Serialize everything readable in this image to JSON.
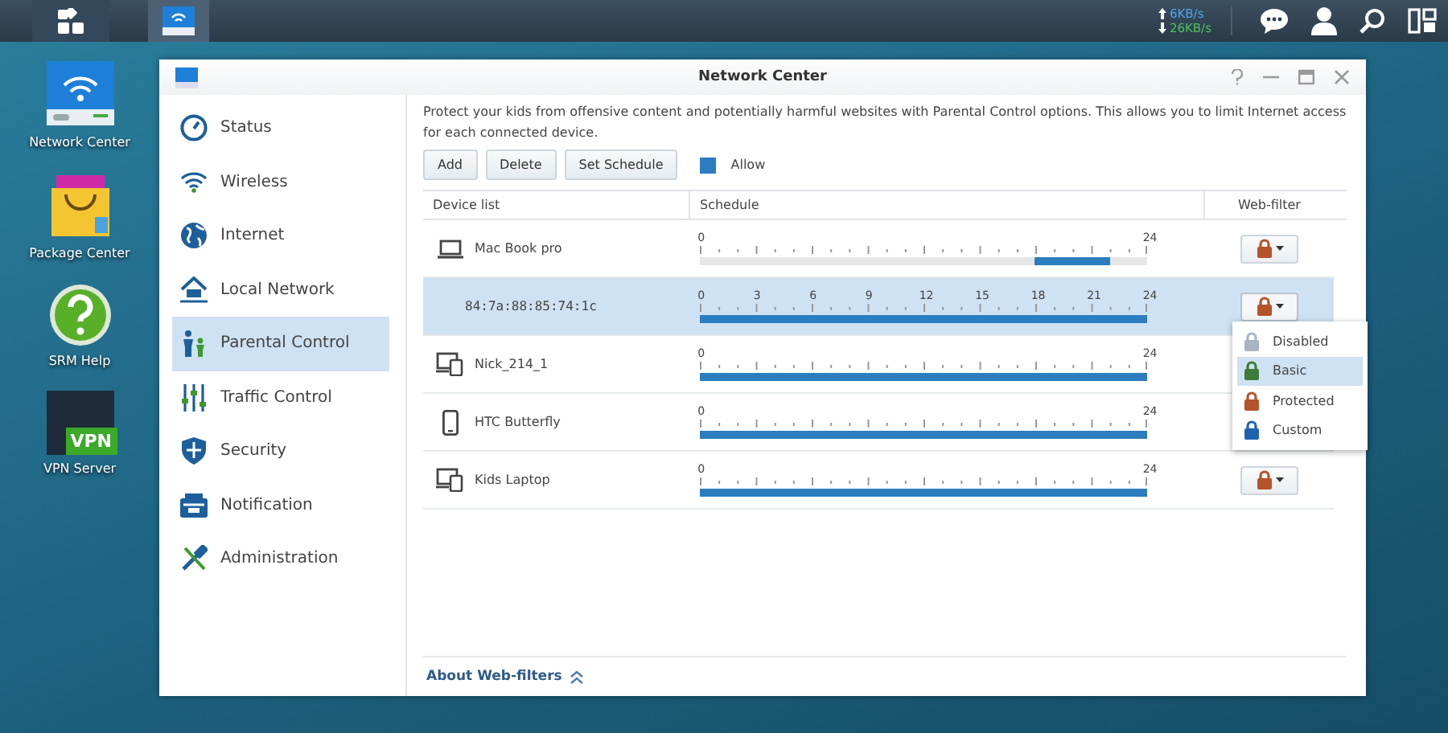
{
  "taskbar": {
    "upload": "6KB/s",
    "download": "26KB/s"
  },
  "desktop_icons": [
    {
      "label": "Network Center",
      "kind": "network"
    },
    {
      "label": "Package Center",
      "kind": "package"
    },
    {
      "label": "SRM Help",
      "kind": "help"
    },
    {
      "label": "VPN Server",
      "kind": "vpn",
      "badge": "VPN"
    }
  ],
  "window": {
    "title": "Network Center"
  },
  "sidebar": {
    "items": [
      {
        "label": "Status",
        "selected": false
      },
      {
        "label": "Wireless",
        "selected": false
      },
      {
        "label": "Internet",
        "selected": false
      },
      {
        "label": "Local Network",
        "selected": false
      },
      {
        "label": "Parental Control",
        "selected": true
      },
      {
        "label": "Traffic Control",
        "selected": false
      },
      {
        "label": "Security",
        "selected": false
      },
      {
        "label": "Notification",
        "selected": false
      },
      {
        "label": "Administration",
        "selected": false
      }
    ]
  },
  "description": "Protect your kids from offensive content and potentially harmful websites with Parental Control options. This allows you to limit Internet access for each connected device.",
  "toolbar": {
    "buttons": [
      "Add",
      "Delete",
      "Set Schedule"
    ],
    "legend": "Allow"
  },
  "table": {
    "columns": [
      "Device list",
      "Schedule",
      "Web-filter"
    ],
    "rows": [
      {
        "device": "Mac Book pro",
        "kind": "laptop",
        "selected": false,
        "scale_labels": [
          "0",
          "24"
        ],
        "allowed_hours": [
          false,
          false,
          false,
          false,
          false,
          false,
          false,
          false,
          false,
          false,
          false,
          false,
          false,
          false,
          false,
          false,
          false,
          false,
          true,
          true,
          true,
          true,
          false,
          false
        ],
        "menu_open": false
      },
      {
        "device": "84:7a:88:85:74:1c",
        "kind": "none",
        "selected": true,
        "menu_open": true,
        "scale_labels": [
          "0",
          "3",
          "6",
          "9",
          "12",
          "15",
          "18",
          "21",
          "24"
        ],
        "allowed_hours": [
          true,
          true,
          true,
          true,
          true,
          true,
          true,
          true,
          true,
          true,
          true,
          true,
          true,
          true,
          true,
          true,
          true,
          true,
          true,
          true,
          true,
          true,
          true,
          true
        ]
      },
      {
        "device": "Nick_214_1",
        "kind": "multi",
        "selected": false,
        "menu_open": false,
        "scale_labels": [
          "0",
          "24"
        ],
        "allowed_hours": [
          true,
          true,
          true,
          true,
          true,
          true,
          true,
          true,
          true,
          true,
          true,
          true,
          true,
          true,
          true,
          true,
          true,
          true,
          true,
          true,
          true,
          true,
          true,
          true
        ]
      },
      {
        "device": "HTC Butterfly",
        "kind": "phone",
        "selected": false,
        "menu_open": false,
        "scale_labels": [
          "0",
          "24"
        ],
        "allowed_hours": [
          true,
          true,
          true,
          true,
          true,
          true,
          true,
          true,
          true,
          true,
          true,
          true,
          true,
          true,
          true,
          true,
          true,
          true,
          true,
          true,
          true,
          true,
          true,
          true
        ]
      },
      {
        "device": "Kids Laptop",
        "kind": "multi",
        "selected": false,
        "menu_open": false,
        "scale_labels": [
          "0",
          "24"
        ],
        "allowed_hours": [
          true,
          true,
          true,
          true,
          true,
          true,
          true,
          true,
          true,
          true,
          true,
          true,
          true,
          true,
          true,
          true,
          true,
          true,
          true,
          true,
          true,
          true,
          true,
          true
        ]
      }
    ]
  },
  "filter_menu": {
    "options": [
      {
        "label": "Disabled",
        "color": "#a9b4c2",
        "selected": false
      },
      {
        "label": "Basic",
        "color": "#3f7a3a",
        "selected": true
      },
      {
        "label": "Protected",
        "color": "#b5532a",
        "selected": false
      },
      {
        "label": "Custom",
        "color": "#1f63b0",
        "selected": false
      }
    ]
  },
  "footer": {
    "link": "About Web-filters",
    "expanded": false
  }
}
